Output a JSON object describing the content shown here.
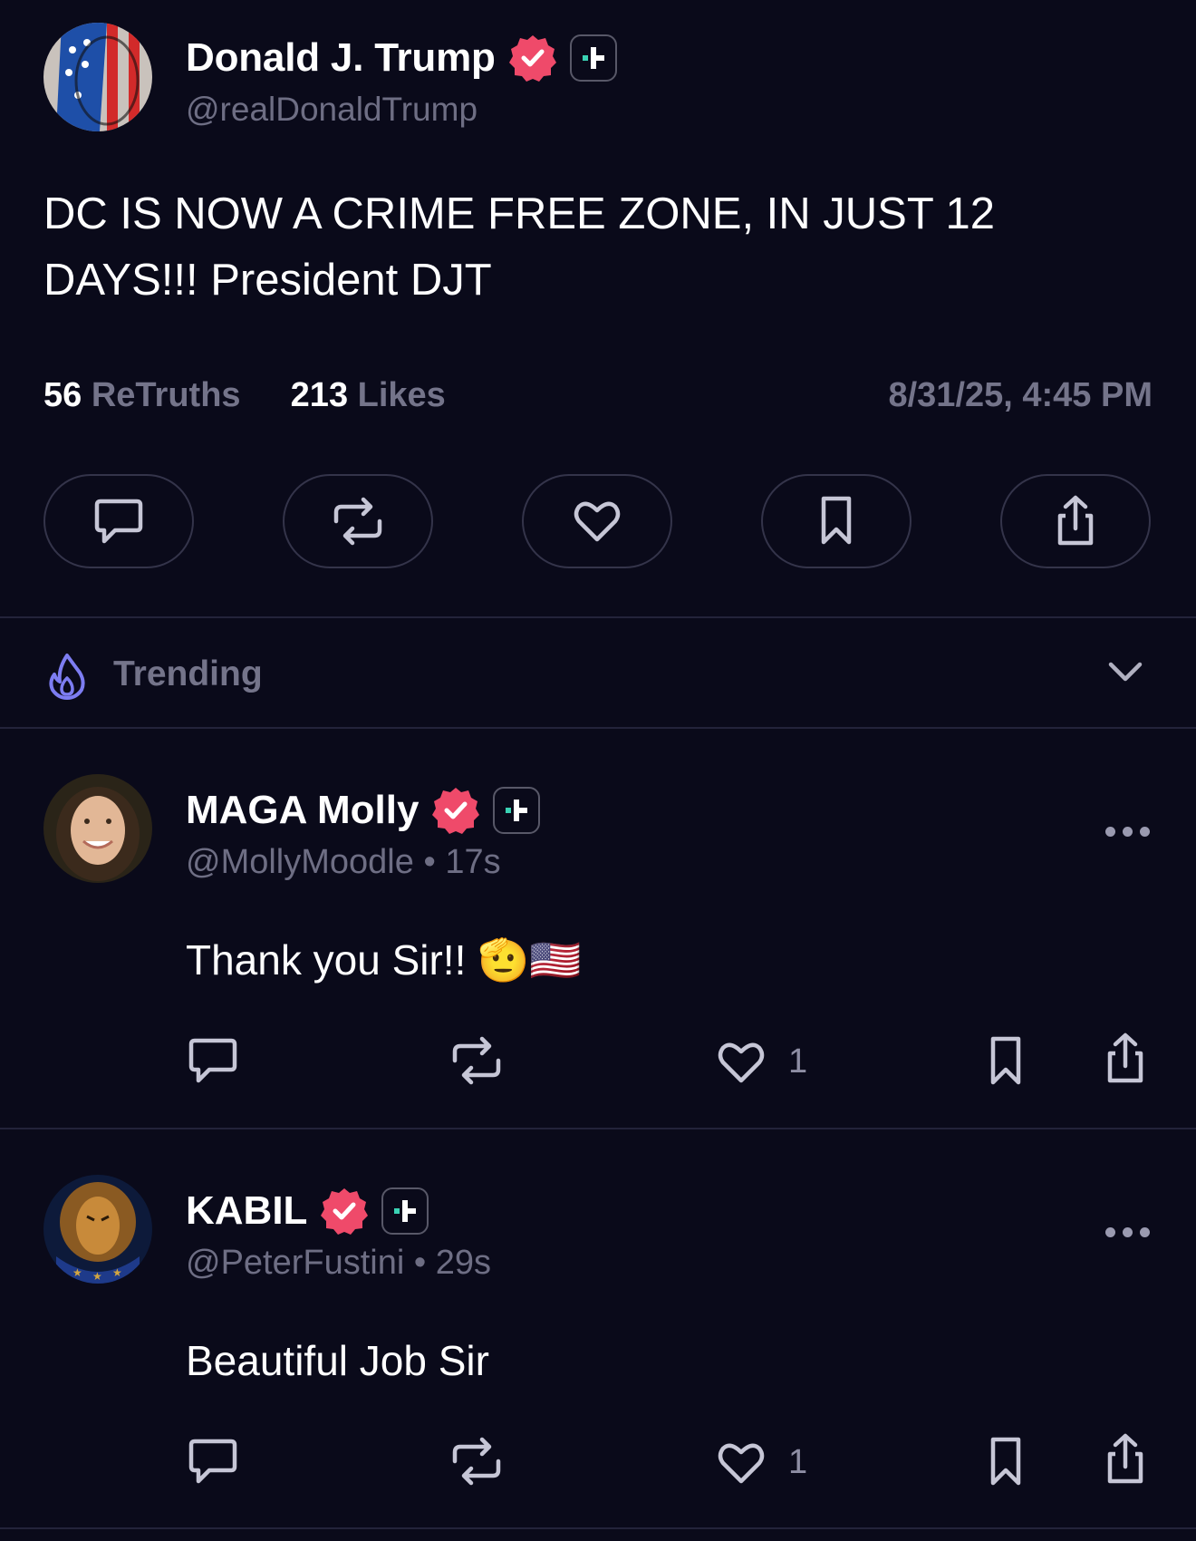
{
  "post": {
    "author_name": "Donald J. Trump",
    "author_handle": "@realDonaldTrump",
    "text_line1": "DC IS NOW A CRIME FREE ZONE, IN JUST 12",
    "text_line2": "DAYS!!! President DJT",
    "retruths_count": "56",
    "retruths_label": "ReTruths",
    "likes_count": "213",
    "likes_label": "Likes",
    "timestamp": "8/31/25, 4:45 PM",
    "actions": [
      "reply-icon",
      "retruth-icon",
      "heart-icon",
      "bookmark-icon",
      "share-icon"
    ]
  },
  "trending": {
    "label": "Trending",
    "icon": "flame-icon"
  },
  "replies": [
    {
      "author_name": "MAGA Molly",
      "author_handle": "@MollyMoodle",
      "age": "• 17s",
      "text": "Thank you Sir!!",
      "emoji": "🫡🇺🇸",
      "likes": "1"
    },
    {
      "author_name": "KABIL",
      "author_handle": "@PeterFustini",
      "age": "• 29s",
      "text": "Beautiful Job Sir",
      "likes": "1"
    }
  ],
  "colors": {
    "background": "#0a0a1a",
    "verified": "#ef4a6a",
    "plus_accent": "#3ad2b4",
    "trending_icon": "#7d7df2",
    "muted_text": "#74748a"
  }
}
